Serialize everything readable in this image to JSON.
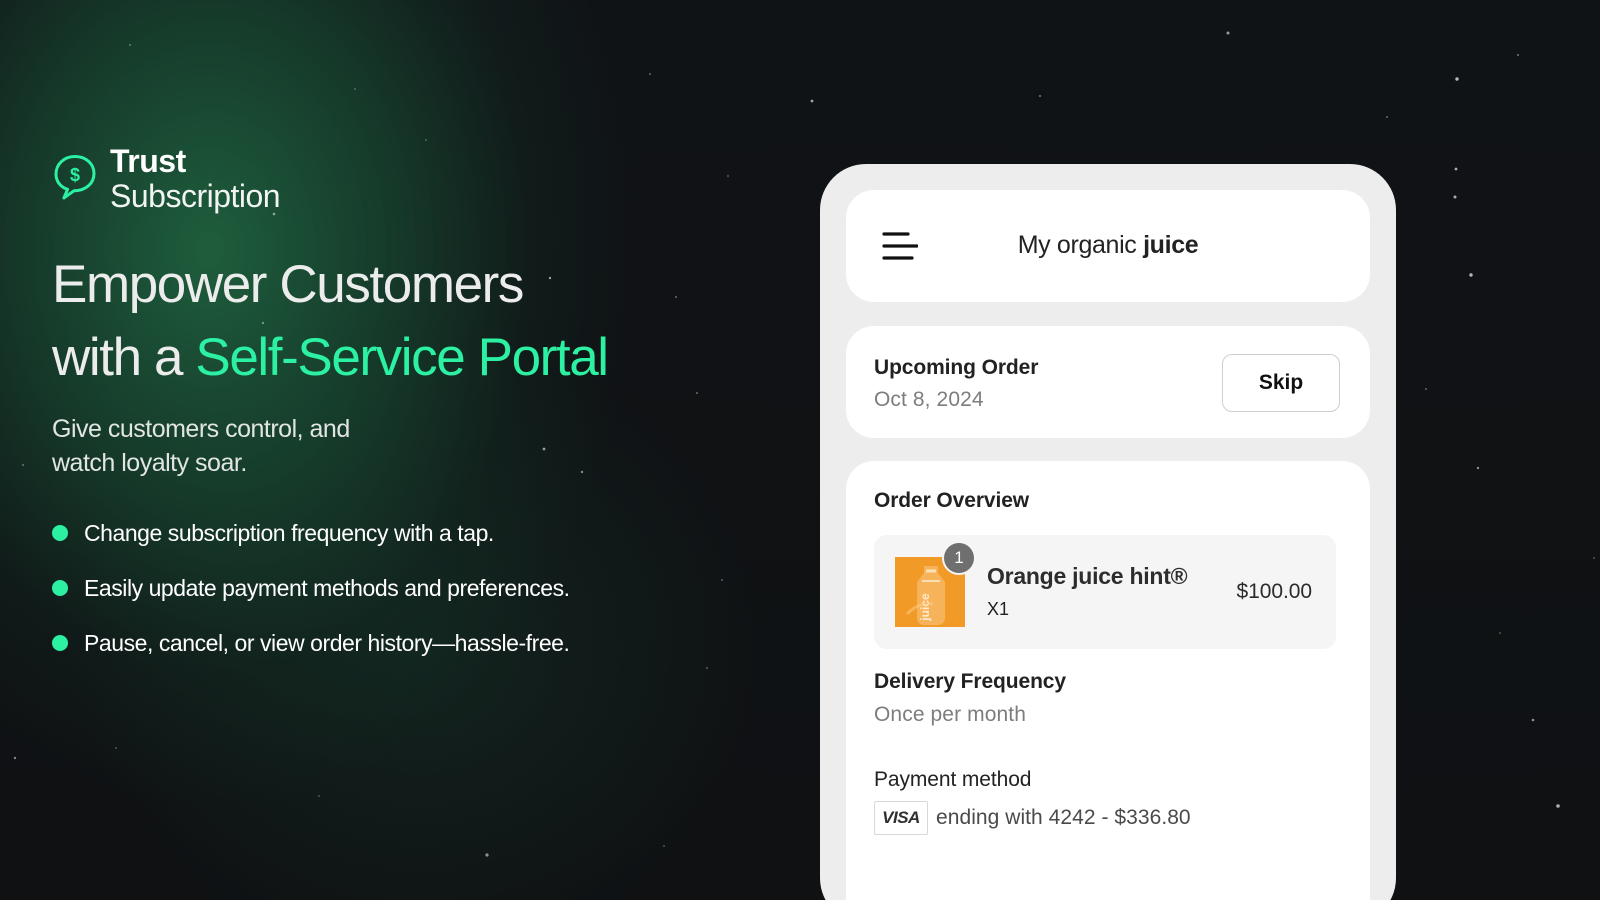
{
  "brand": {
    "title": "Trust",
    "subtitle": "Subscription",
    "icon": "currency-chat-bubble-icon",
    "accent_color": "#2cf0a2"
  },
  "hero": {
    "headline_line_1": "Empower Customers",
    "headline_prefix_line_2": "with a ",
    "headline_accent": "Self-Service Portal",
    "subtext": "Give customers control, and watch loyalty soar."
  },
  "features": [
    {
      "label": "Change subscription frequency with a tap."
    },
    {
      "label": "Easily update payment methods and preferences."
    },
    {
      "label": "Pause, cancel, or view order history—hassle-free."
    }
  ],
  "portal": {
    "menu_icon": "hamburger-menu-icon",
    "store_name_regular": "My organic",
    "store_name_bold": "juice",
    "upcoming": {
      "title": "Upcoming Order",
      "date": "Oct 8, 2024",
      "skip_label": "Skip"
    },
    "overview": {
      "title": "Order Overview",
      "product": {
        "badge_count": "1",
        "name": "Orange juice hint®",
        "quantity": "X1",
        "price": "$100.00",
        "image_icon": "orange-juice-product-image"
      },
      "frequency": {
        "title": "Delivery Frequency",
        "value": "Once per month"
      },
      "payment": {
        "title": "Payment method",
        "card_brand": "VISA",
        "summary": "ending with 4242 - $336.80"
      }
    }
  },
  "colors": {
    "background": "#111214",
    "green_glow": "#227348",
    "phone_shell": "#ededed",
    "card_background": "#ffffff"
  }
}
